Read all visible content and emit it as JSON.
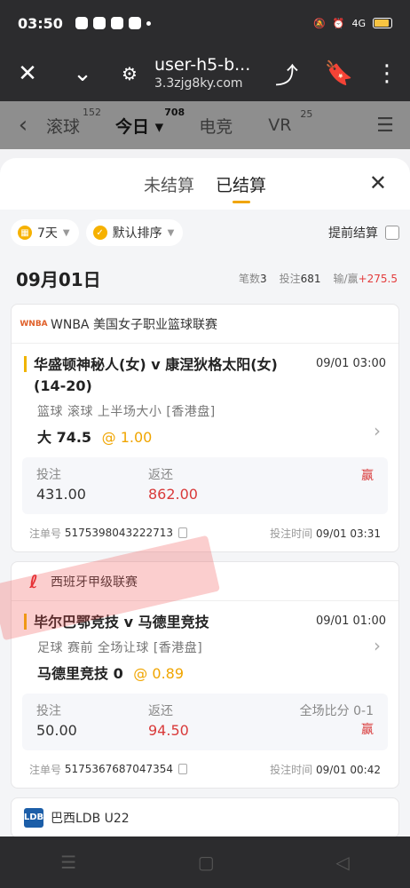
{
  "status": {
    "time": "03:50",
    "net": "4G"
  },
  "browser": {
    "title": "user-h5-b...",
    "domain": "3.3zjg8ky.com"
  },
  "nav": {
    "tabs": [
      {
        "label": "滚球",
        "count": "152"
      },
      {
        "label": "今日",
        "count": "708"
      },
      {
        "label": "电竞",
        "count": ""
      },
      {
        "label": "VR",
        "count": "25"
      }
    ]
  },
  "sheet": {
    "tabs": [
      "未结算",
      "已结算"
    ],
    "close": "✕",
    "filter_days": "7天",
    "filter_sort": "默认排序",
    "early_settle": "提前结算",
    "date": "09月01日",
    "stats": {
      "count_label": "笔数",
      "count": "3",
      "stake_label": "投注",
      "stake": "681",
      "winloss_label": "输/赢",
      "winloss": "+275.5"
    }
  },
  "bets": [
    {
      "league": "WNBA 美国女子职业篮球联赛",
      "logo": "WNBA",
      "teams": "华盛顿神秘人(女) v 康涅狄格太阳(女)",
      "score": "(14-20)",
      "time": "09/01 03:00",
      "market": "篮球  滚球  上半场大小 [香港盘]",
      "pick": "大 74.5",
      "odds": "1.00",
      "stake_label": "投注",
      "stake": "431.00",
      "return_label": "返还",
      "return": "862.00",
      "score_label": "",
      "result": "赢",
      "order_label": "注单号",
      "order_no": "5175398043222713",
      "bet_time_label": "投注时间",
      "bet_time": "09/01 03:31"
    },
    {
      "league": "西班牙甲级联赛",
      "logo": "LL",
      "teams": "毕尔巴鄂竞技 v 马德里竞技",
      "score": "",
      "time": "09/01 01:00",
      "market": "足球  赛前  全场让球 [香港盘]",
      "pick": "马德里竞技 0",
      "odds": "0.89",
      "stake_label": "投注",
      "stake": "50.00",
      "return_label": "返还",
      "return": "94.50",
      "score_label": "全场比分 0-1",
      "result": "赢",
      "order_label": "注单号",
      "order_no": "5175367687047354",
      "bet_time_label": "投注时间",
      "bet_time": "09/01 00:42"
    },
    {
      "league": "巴西LDB U22",
      "logo": "LDB"
    }
  ]
}
